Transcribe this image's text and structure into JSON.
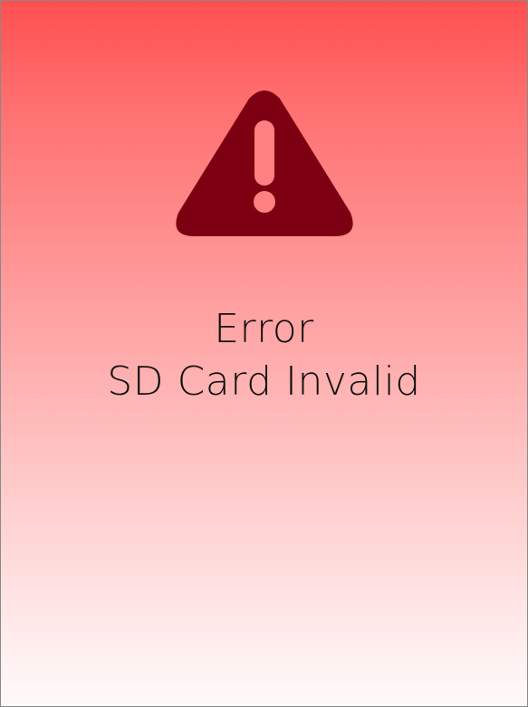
{
  "alert": {
    "title": "Error",
    "message": "SD Card Invalid",
    "icon": "warning-triangle-icon",
    "icon_color": "#7d0012",
    "background_top": "#ff4f4f",
    "background_bottom": "#fffafa"
  }
}
